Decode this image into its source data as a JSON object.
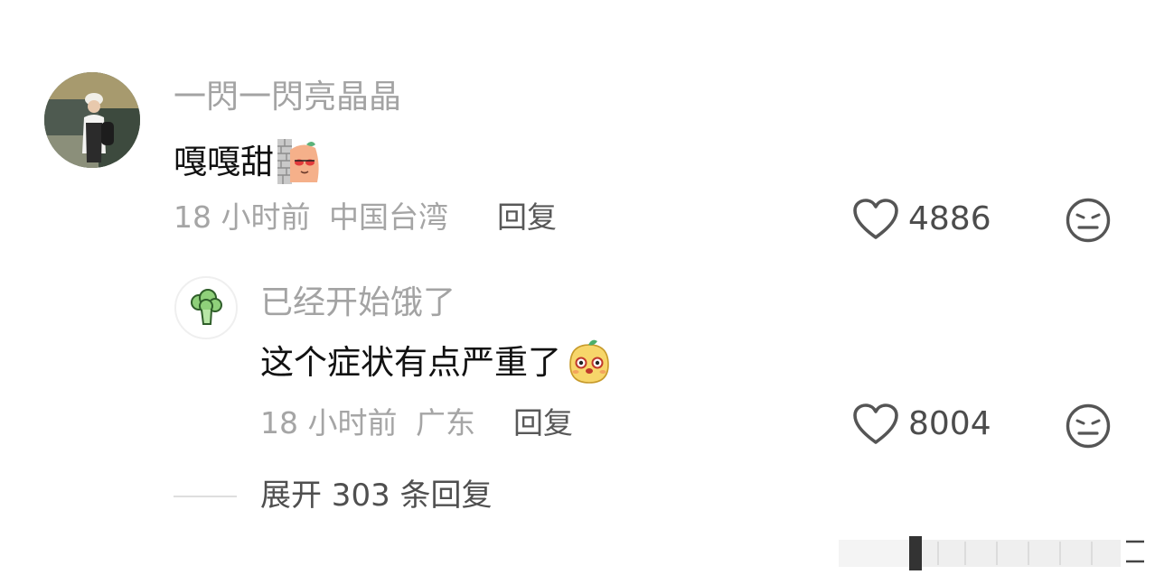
{
  "comment": {
    "username": "一閃一閃亮晶晶",
    "text": "嘎嘎甜",
    "sticker_icon": "wall-peek-sticker-icon",
    "time": "18 小时前",
    "location": "中国台湾",
    "reply_label": "回复",
    "like_count": "4886"
  },
  "reply": {
    "username": "已经开始饿了",
    "text": "这个症状有点严重了",
    "sticker_icon": "potato-face-sticker-icon",
    "time": "18 小时前",
    "location": "广东",
    "reply_label": "回复",
    "like_count": "8004"
  },
  "expand_label": "展开 303 条回复",
  "icons": {
    "like": "heart-outline-icon",
    "dislike": "meh-face-icon",
    "avatar_reply": "broccoli-icon"
  },
  "colors": {
    "text_primary": "#111111",
    "text_secondary": "#a3a3a3",
    "icon": "#555555"
  }
}
